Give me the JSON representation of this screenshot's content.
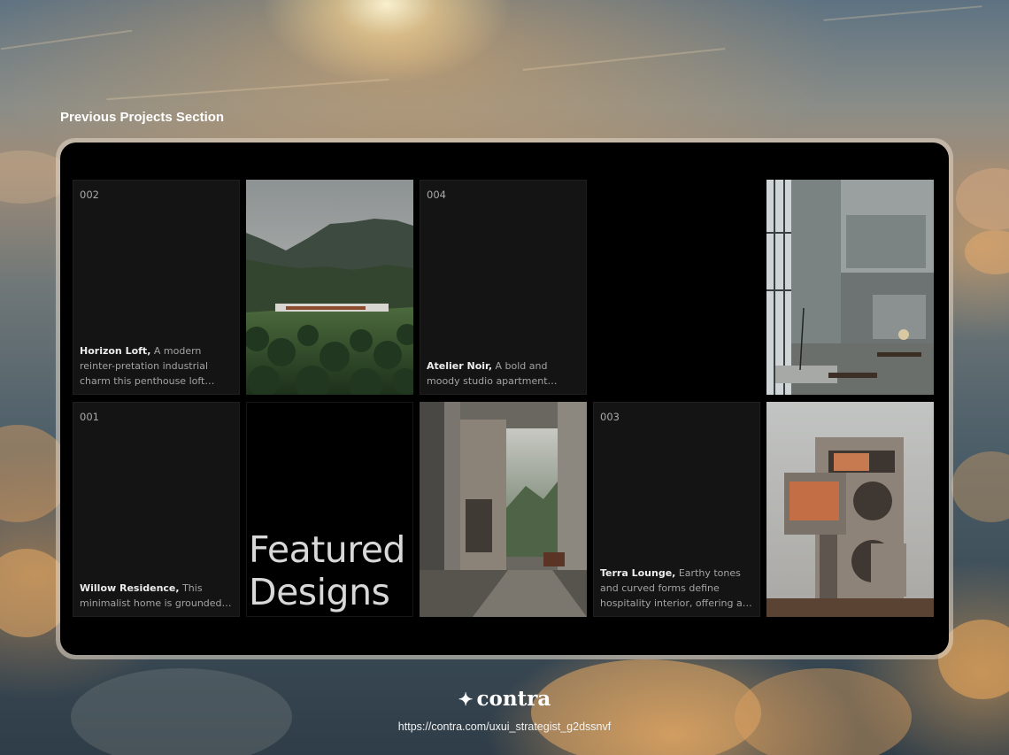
{
  "section": {
    "title": "Previous Projects Section"
  },
  "projects": [
    {
      "number": "002",
      "name": "Horizon Loft,",
      "description": "A modern reinter-pretation industrial charm this penthouse loft combines raw co..."
    },
    {
      "number": "004",
      "name": "Atelier Noir,",
      "description": "A bold and moody studio apartment designed for a..."
    },
    {
      "number": "001",
      "name": "Willow Residence,",
      "description": "This minimalist home is grounded in natural ma..."
    },
    {
      "number": "003",
      "name": "Terra Lounge,",
      "description": "Earthy tones and curved forms define hospitality interior, offering a grounded an..."
    }
  ],
  "featured": {
    "line1": "Featured",
    "line2": "Designs"
  },
  "images": [
    {
      "icon": "mountain-house-photo"
    },
    {
      "icon": "concrete-loft-photo"
    },
    {
      "icon": "window-valley-photo"
    },
    {
      "icon": "concrete-house-photo"
    }
  ],
  "footer": {
    "logo_mark": "✦",
    "logo_text": "contra",
    "url": "https://contra.com/uxui_strategist_g2dssnvf"
  },
  "colors": {
    "panel": "#000000",
    "card": "#141414",
    "frame": "#d9cfc2"
  }
}
